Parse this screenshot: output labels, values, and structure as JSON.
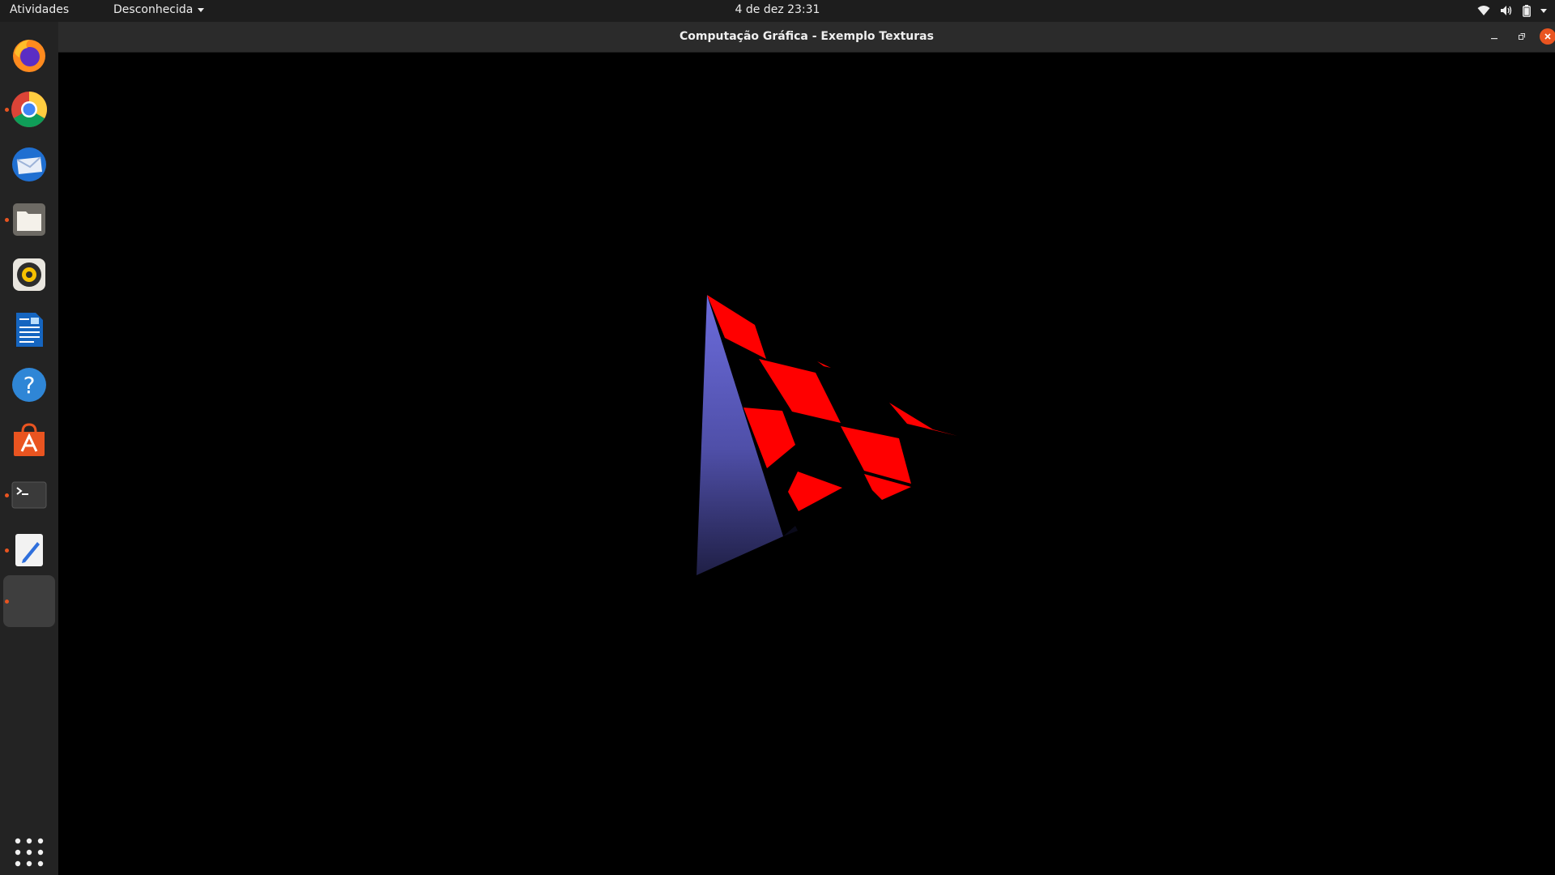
{
  "topbar": {
    "activities_label": "Atividades",
    "app_menu_label": "Desconhecida",
    "datetime": "4 de dez  23:31",
    "status_icons": [
      "wifi-icon",
      "volume-icon",
      "battery-icon",
      "system-menu-caret-icon"
    ]
  },
  "dock": {
    "items": [
      {
        "name": "firefox",
        "icon": "firefox-icon",
        "running": false
      },
      {
        "name": "chrome",
        "icon": "chrome-icon",
        "running": true
      },
      {
        "name": "thunderbird",
        "icon": "thunderbird-icon",
        "running": false
      },
      {
        "name": "files",
        "icon": "folder-icon",
        "running": true
      },
      {
        "name": "rhythmbox",
        "icon": "rhythmbox-icon",
        "running": false
      },
      {
        "name": "libreoffice-writer",
        "icon": "writer-icon",
        "running": false
      },
      {
        "name": "help",
        "icon": "help-icon",
        "running": false
      },
      {
        "name": "software",
        "icon": "software-center-icon",
        "running": false
      },
      {
        "name": "terminal",
        "icon": "terminal-icon",
        "running": true
      },
      {
        "name": "text-editor",
        "icon": "text-editor-icon",
        "running": true
      },
      {
        "name": "current-app",
        "icon": "blank-app-icon",
        "running": true
      }
    ],
    "show_apps_icon": "app-grid-icon"
  },
  "window": {
    "title": "Computação Gráfica - Exemplo Texturas",
    "controls": [
      "minimize-icon",
      "maximize-icon",
      "close-icon"
    ]
  },
  "colors": {
    "accent": "#e95420",
    "checker_red": "#ff0000",
    "blue_face_light": "#6a6ad8",
    "blue_face_dark": "#23234a",
    "background": "#000000"
  }
}
